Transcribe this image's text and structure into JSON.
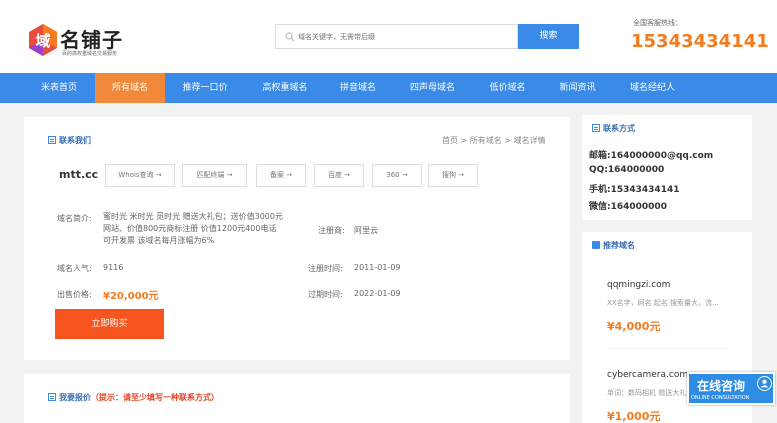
{
  "header": {
    "logo_mark": "域",
    "logo_text": "名铺子",
    "logo_sub": "百的高权重域名交易服务",
    "search_placeholder": "域名关键字，无需带后缀",
    "search_button": "搜索",
    "hotline_label": "全国客服热线：",
    "hotline_number": "15343434141"
  },
  "nav": {
    "items": [
      "米表首页",
      "所有域名",
      "推荐一口价",
      "高权重域名",
      "拼音域名",
      "四声母域名",
      "低价域名",
      "新闻资讯",
      "域名经纪人"
    ],
    "active": "所有域名"
  },
  "main": {
    "title": "联系我们",
    "breadcrumb": "首页 > 所有域名 > 域名详情",
    "domain": "mtt.cc",
    "tools": [
      "Whois查询",
      "匹配终端",
      "备案",
      "百度",
      "360",
      "搜狗"
    ],
    "intro_label": "域名简介:",
    "intro_text": "蜜时光 米时光 觅时光 赠送大礼包；送价值3000元网站、价值800元商标注册 价值1200元400电话 可开发票 该域名每月涨幅为6%",
    "registrar_label": "注册商:",
    "registrar_value": "阿里云",
    "popularity_label": "域名人气:",
    "popularity_value": "9116",
    "reg_time_label": "注册时间:",
    "reg_time_value": "2011-01-09",
    "price_label": "出售价格:",
    "price_value": "¥20,000元",
    "expire_label": "过期时间:",
    "expire_value": "2022-01-09",
    "buy_button": "立即购买"
  },
  "offer": {
    "title": "我要报价",
    "hint": "（提示：请至少填写一种联系方式）"
  },
  "contact": {
    "title": "联系方式",
    "email": "邮箱:164000000@qq.com",
    "qq": "QQ:164000000",
    "phone": "手机:15343434141",
    "wechat": "微信:164000000"
  },
  "recommend": {
    "title": "推荐域名",
    "items": [
      {
        "domain": "qqmingzi.com",
        "desc": "XX名字，网名 起名 搜索量大，流...",
        "price": "¥4,000元"
      },
      {
        "domain": "cybercamera.com",
        "desc": "单词：数码相机 赠送大礼包",
        "price": "¥1,000元"
      }
    ]
  },
  "consult": {
    "main": "在线咨询",
    "sub": "ONLINE CONSULTATION"
  },
  "colors": {
    "brand_blue": "#3a8ae8",
    "accent_orange": "#f47b1e",
    "buy_red": "#f7541f"
  }
}
